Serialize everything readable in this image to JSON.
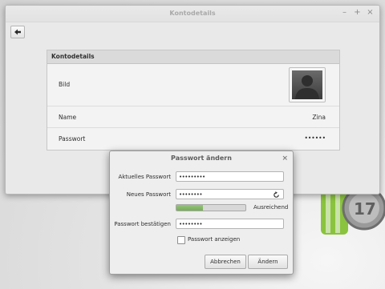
{
  "main_window": {
    "title": "Kontodetails",
    "controls": [
      "–",
      "+",
      "×"
    ]
  },
  "panel": {
    "heading": "Kontodetails",
    "rows": [
      {
        "label": "Bild",
        "value": ""
      },
      {
        "label": "Name",
        "value": "Zina"
      },
      {
        "label": "Passwort",
        "value": "••••••"
      }
    ]
  },
  "dialog": {
    "title": "Passwort ändern",
    "close": "×",
    "current_label": "Aktuelles Passwort",
    "current_value": "•••••••••",
    "new_label": "Neues Passwort",
    "new_value": "••••••••",
    "strength_level": 0.38,
    "strength_label": "Ausreichend",
    "confirm_label": "Passwort bestätigen",
    "confirm_value": "••••••••",
    "show_label": "Passwort anzeigen",
    "show_checked": false,
    "cancel_label": "Abbrechen",
    "ok_label": "Ändern"
  },
  "colors": {
    "strength_fill": "#7fb262",
    "desktop_logo_green": "#8ac33e"
  }
}
